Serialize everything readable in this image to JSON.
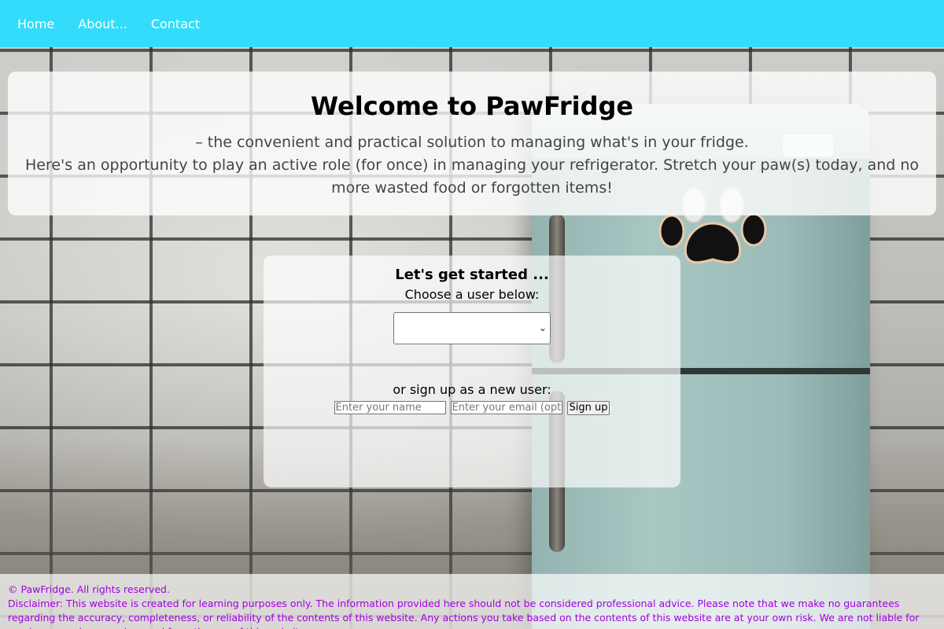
{
  "nav": {
    "items": [
      {
        "label": "Home"
      },
      {
        "label": "About..."
      },
      {
        "label": "Contact"
      }
    ]
  },
  "welcome": {
    "title": "Welcome to PawFridge",
    "tagline": "– the convenient and practical solution to managing what's in your fridge.",
    "pitch": "Here's an opportunity to play an active role (for once) in managing your refrigerator. Stretch your paw(s) today, and no more wasted food or forgotten items!"
  },
  "start": {
    "title": "Let's get started ...",
    "choose_label": "Choose a user below:",
    "selected_user": "",
    "signup_label": "or sign up as a new user:",
    "name_placeholder": "Enter your name",
    "email_placeholder": "Enter your email (optional)",
    "signup_button": "Sign up"
  },
  "footer": {
    "copyright": "© PawFridge. All rights reserved.",
    "disclaimer": "Disclaimer: This website is created for learning purposes only. The information provided here should not be considered professional advice. Please note that we make no guarantees regarding the accuracy, completeness, or reliability of the contents of this website. Any actions you take based on the contents of this website are at your own risk. We are not liable for any losses or damages incurred from the use of this website."
  },
  "colors": {
    "nav_bg": "#33dcfb",
    "footer_text": "#a000e0"
  },
  "icons": {
    "select_chevron": "chevron-down-icon",
    "fridge_magnet": "paw-icon"
  }
}
